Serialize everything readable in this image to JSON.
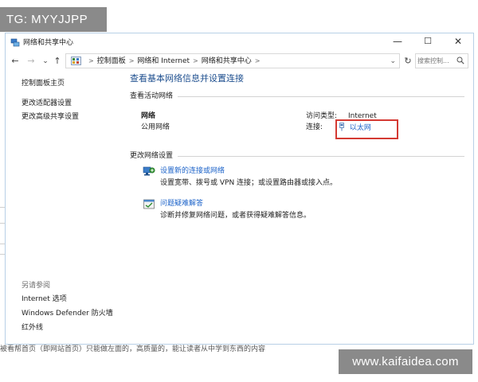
{
  "watermarks": {
    "top": "TG: MYYJJPP",
    "bottom": "www.kaifaidea.com"
  },
  "background_text": "被看帮首页（即网站首页）只能做左面的，高质量的，能让读者从中学到东西的内容",
  "window": {
    "title": "网络和共享中心",
    "controls": {
      "minimize": "—",
      "maximize": "☐",
      "close": "✕"
    }
  },
  "nav": {
    "back": "←",
    "forward": "→",
    "recent": "⌄",
    "up": "↑",
    "breadcrumbs": [
      "控制面板",
      "网络和 Internet",
      "网络和共享中心"
    ],
    "separator": ">",
    "dropdown": "⌄",
    "refresh": "↻",
    "search_placeholder": "搜索控制...",
    "search_icon": "search-icon"
  },
  "sidebar": {
    "items": [
      {
        "label": "控制面板主页"
      },
      {
        "label": "更改适配器设置"
      },
      {
        "label": "更改高级共享设置"
      }
    ],
    "see_also_label": "另请参阅",
    "see_also": [
      {
        "label": "Internet 选项"
      },
      {
        "label": "Windows Defender 防火墙"
      },
      {
        "label": "红外线"
      }
    ]
  },
  "main": {
    "title": "查看基本网络信息并设置连接",
    "active_networks_label": "查看活动网络",
    "network": {
      "name": "网络",
      "type": "公用网络",
      "access_type_label": "访问类型:",
      "access_type_value": "Internet",
      "connections_label": "连接:",
      "connection_name": "以太网"
    },
    "change_settings_label": "更改网络设置",
    "tasks": [
      {
        "link": "设置新的连接或网络",
        "description": "设置宽带、拨号或 VPN 连接；或设置路由器或接入点。",
        "icon": "network-setup-icon"
      },
      {
        "link": "问题疑难解答",
        "description": "诊断并修复网络问题，或者获得疑难解答信息。",
        "icon": "troubleshoot-icon"
      }
    ]
  },
  "colors": {
    "link": "#1c63c9",
    "title": "#1e4f8f",
    "highlight": "#d43a33",
    "watermark_bg": "#8a8a8a"
  }
}
